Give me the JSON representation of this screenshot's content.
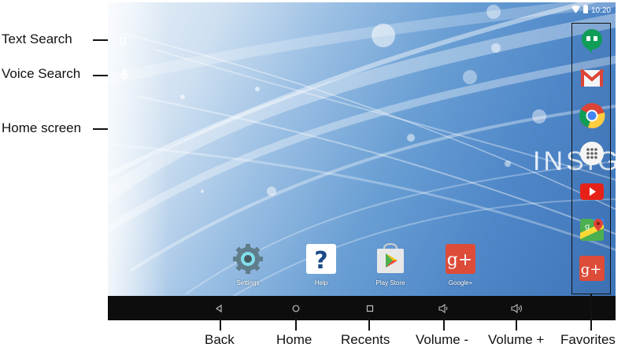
{
  "status_bar": {
    "time": "10:20"
  },
  "brand_text": "INSIG",
  "callouts": {
    "text_search": "Text Search",
    "voice_search": "Voice Search",
    "home_screen": "Home screen"
  },
  "home_apps": [
    {
      "label": "Settings",
      "icon": "gear-icon"
    },
    {
      "label": "Help",
      "icon": "question-icon"
    },
    {
      "label": "Play Store",
      "icon": "play-store-icon"
    },
    {
      "label": "Google+",
      "icon": "google-plus-icon"
    }
  ],
  "favorites": [
    "hangouts-icon",
    "gmail-icon",
    "chrome-icon",
    "app-drawer-icon",
    "youtube-icon",
    "maps-icon",
    "google-plus-icon"
  ],
  "nav_labels": {
    "back": "Back",
    "home": "Home",
    "recents": "Recents",
    "volume_down": "Volume -",
    "volume_up": "Volume +",
    "favorites": "Favorites"
  },
  "colors": {
    "navbar": "#0d0d0d",
    "screen_blue": "#4f87c8"
  }
}
